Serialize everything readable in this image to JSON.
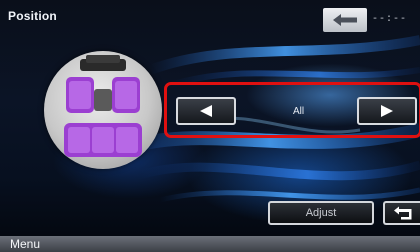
{
  "screen": {
    "title": "Position"
  },
  "header": {
    "back_icon": "back-arrow-icon",
    "status_text": "--:--"
  },
  "seat_map": {
    "icon": "car-seats-icon",
    "highlight_color": "#a74bd8"
  },
  "position_selector": {
    "value": "All",
    "left_icon": "left-arrow-icon",
    "right_icon": "right-arrow-icon",
    "focus_color": "#e01010"
  },
  "footer": {
    "adjust_label": "Adjust",
    "return_icon": "return-icon",
    "menu_label": "Menu"
  }
}
